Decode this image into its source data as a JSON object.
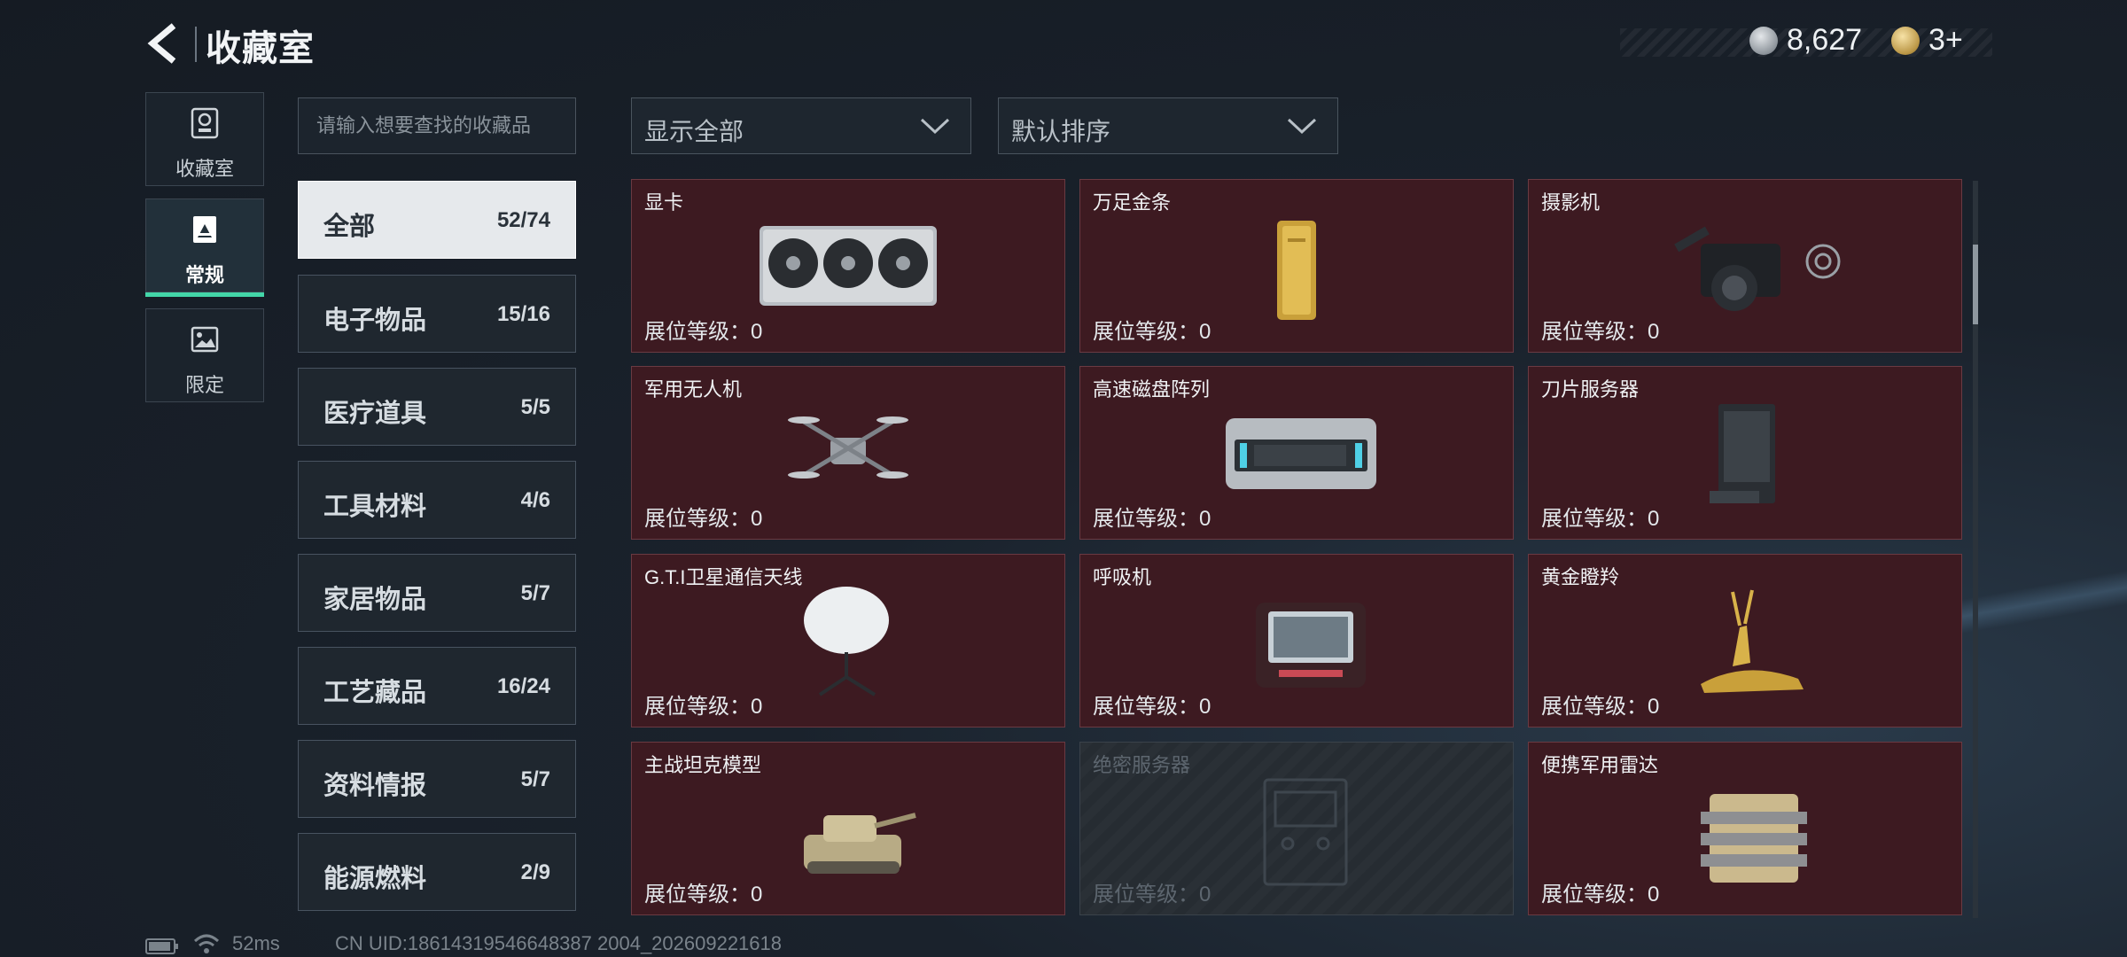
{
  "header": {
    "title": "收藏室"
  },
  "currency": [
    {
      "icon": "silver-coin-icon",
      "value": "8,627"
    },
    {
      "icon": "gold-badge-icon",
      "value": "3+"
    }
  ],
  "left_nav": [
    {
      "label": "收藏室",
      "icon": "trophy-icon",
      "active": false
    },
    {
      "label": "常规",
      "icon": "photo-card-icon",
      "active": true
    },
    {
      "label": "限定",
      "icon": "landscape-icon",
      "active": false
    }
  ],
  "search": {
    "placeholder": "请输入想要查找的收藏品"
  },
  "filters": {
    "show": "显示全部",
    "sort": "默认排序"
  },
  "categories": [
    {
      "name": "全部",
      "count": "52/74"
    },
    {
      "name": "电子物品",
      "count": "15/16"
    },
    {
      "name": "医疗道具",
      "count": "5/5"
    },
    {
      "name": "工具材料",
      "count": "4/6"
    },
    {
      "name": "家居物品",
      "count": "5/7"
    },
    {
      "name": "工艺藏品",
      "count": "16/24"
    },
    {
      "name": "资料情报",
      "count": "5/7"
    },
    {
      "name": "能源燃料",
      "count": "2/9"
    }
  ],
  "items": [
    {
      "name": "显卡",
      "level": "展位等级：0",
      "icon": "graphics-card-icon"
    },
    {
      "name": "万足金条",
      "level": "展位等级：0",
      "icon": "gold-bar-icon"
    },
    {
      "name": "摄影机",
      "level": "展位等级：0",
      "icon": "video-camera-icon"
    },
    {
      "name": "军用无人机",
      "level": "展位等级：0",
      "icon": "drone-icon"
    },
    {
      "name": "高速磁盘阵列",
      "level": "展位等级：0",
      "icon": "disk-array-icon"
    },
    {
      "name": "刀片服务器",
      "level": "展位等级：0",
      "icon": "blade-server-icon"
    },
    {
      "name": "G.T.I卫星通信天线",
      "level": "展位等级：0",
      "icon": "satellite-dish-icon"
    },
    {
      "name": "呼吸机",
      "level": "展位等级：0",
      "icon": "ventilator-icon"
    },
    {
      "name": "黄金瞪羚",
      "level": "展位等级：0",
      "icon": "golden-gazelle-icon"
    },
    {
      "name": "主战坦克模型",
      "level": "展位等级：0",
      "icon": "tank-model-icon"
    },
    {
      "name": "绝密服务器",
      "level": "展位等级：0",
      "icon": "secret-server-icon"
    },
    {
      "name": "便携军用雷达",
      "level": "展位等级：0",
      "icon": "portable-radar-icon"
    }
  ],
  "footer": {
    "ping": "52ms",
    "uid": "CN UID:18614319546648387 2004_202609221618"
  }
}
